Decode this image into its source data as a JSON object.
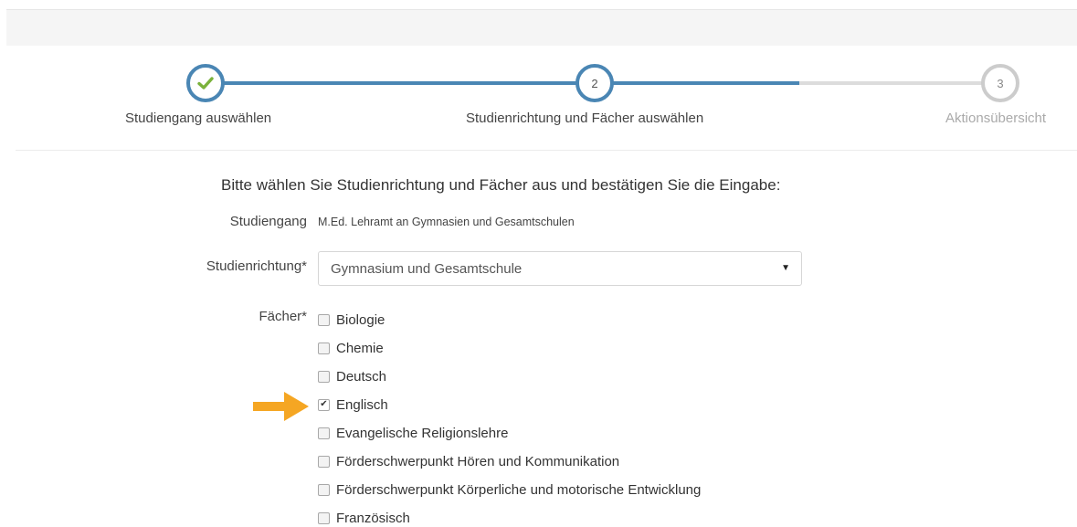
{
  "stepper": {
    "steps": [
      {
        "label": "Studiengang auswählen",
        "marker": "check-icon",
        "state": "done"
      },
      {
        "label": "Studienrichtung und Fächer auswählen",
        "marker": "2",
        "state": "current"
      },
      {
        "label": "Aktionsübersicht",
        "marker": "3",
        "state": "todo"
      }
    ]
  },
  "form": {
    "instruction": "Bitte wählen Sie Studienrichtung und Fächer aus und bestätigen Sie die Eingabe:",
    "studiengang_label": "Studiengang",
    "studiengang_value": "M.Ed. Lehramt an Gymnasien und Gesamtschulen",
    "studienrichtung_label": "Studienrichtung*",
    "studienrichtung_selected": "Gymnasium und Gesamtschule",
    "faecher_label": "Fächer*",
    "faecher": [
      {
        "label": "Biologie",
        "checked": false
      },
      {
        "label": "Chemie",
        "checked": false
      },
      {
        "label": "Deutsch",
        "checked": false
      },
      {
        "label": "Englisch",
        "checked": true
      },
      {
        "label": "Evangelische Religionslehre",
        "checked": false
      },
      {
        "label": "Förderschwerpunkt Hören und Kommunikation",
        "checked": false
      },
      {
        "label": "Förderschwerpunkt Körperliche und motorische Entwicklung",
        "checked": false
      },
      {
        "label": "Französisch",
        "checked": false
      }
    ]
  },
  "colors": {
    "accent": "#4a86b4",
    "success": "#7ab23b",
    "arrow": "#f5a623",
    "inactive": "#cccccc"
  },
  "icons": {
    "select_caret": "▼",
    "checkbox_check": "✔",
    "highlight_arrow": "arrow-right-icon"
  }
}
